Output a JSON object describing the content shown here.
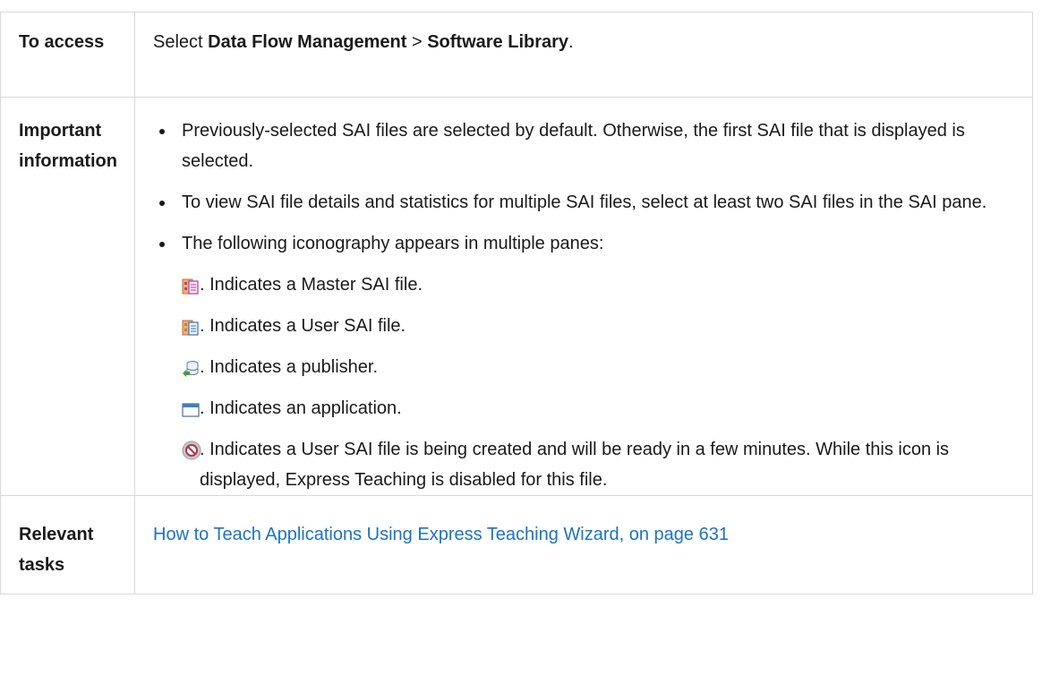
{
  "rows": {
    "access": {
      "label": "To access",
      "prefix": "Select ",
      "path_1": "Data Flow Management",
      "separator": " > ",
      "path_2": "Software Library",
      "suffix": "."
    },
    "important": {
      "label_line1": "Important",
      "label_line2": "information",
      "bullets": [
        "Previously-selected SAI files are selected by default. Otherwise, the first SAI file that is displayed is selected.",
        "To view SAI file details and statistics for multiple SAI files, select at least two SAI files in the SAI pane.",
        "The following iconography appears in multiple panes:"
      ],
      "icons": [
        {
          "icon": "master-sai-file-icon",
          "text": ". Indicates a Master SAI file."
        },
        {
          "icon": "user-sai-file-icon",
          "text": ". Indicates a User SAI file."
        },
        {
          "icon": "publisher-icon",
          "text": ". Indicates a publisher."
        },
        {
          "icon": "application-icon",
          "text": ". Indicates an application."
        },
        {
          "icon": "creating-sai-file-icon",
          "text": ". Indicates a User SAI file is being created and will be ready in a few minutes. While this icon is displayed, Express Teaching is disabled for this file."
        }
      ]
    },
    "tasks": {
      "label_line1": "Relevant",
      "label_line2": "tasks",
      "link_text": "How to Teach Applications Using Express Teaching Wizard, on page 631"
    }
  },
  "colors": {
    "link": "#1d73c2",
    "border": "#d9d9d9",
    "text": "#1a1a1a"
  }
}
